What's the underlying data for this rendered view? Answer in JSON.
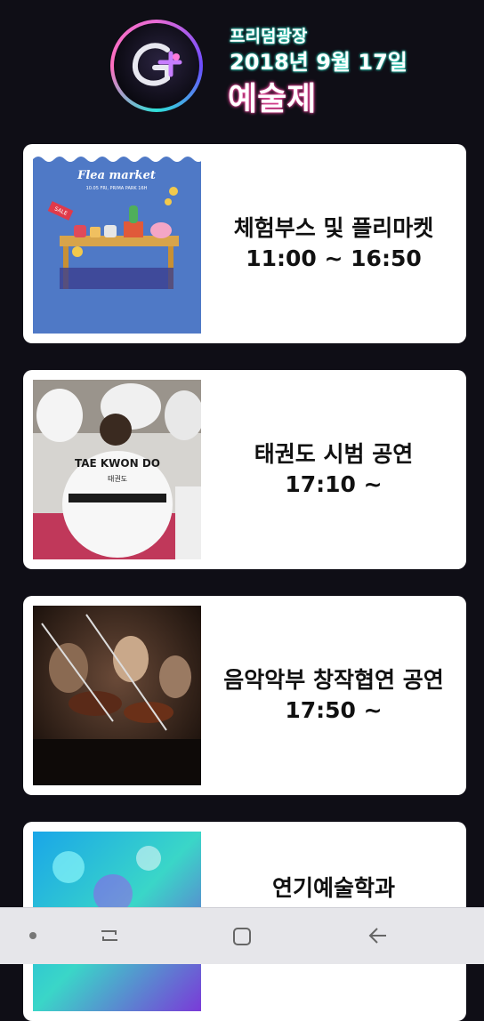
{
  "header": {
    "place": "프리덤광장",
    "date": "2018년 9월 17일",
    "title": "예술제",
    "logo_icon": "festival-logo-icon"
  },
  "events": [
    {
      "name": "체험부스 및 플리마켓",
      "time": "11:00 ~ 16:50",
      "flyer": {
        "title": "Flea market",
        "subtitle": "10.05 FRI, PRIMA PARK 16H",
        "tag": "SALE"
      }
    },
    {
      "name": "태권도 시범 공연",
      "time": "17:10 ~",
      "photo": {
        "uniform_back": "TAE KWON DO",
        "uniform_korean": "태권도"
      }
    },
    {
      "name": "음악악부 창작협연 공연",
      "time": "17:50 ~"
    },
    {
      "name": "연기예술학과",
      "time": ""
    }
  ],
  "navbar": {
    "icons": [
      "dot-icon",
      "recent-apps-icon",
      "home-icon",
      "back-icon"
    ]
  },
  "colors": {
    "background": "#0f0e16",
    "card": "#ffffff",
    "cyan_glow": "#2fe0c8",
    "pink_glow": "#ff4fa8",
    "navbar": "#e6e6ea"
  }
}
